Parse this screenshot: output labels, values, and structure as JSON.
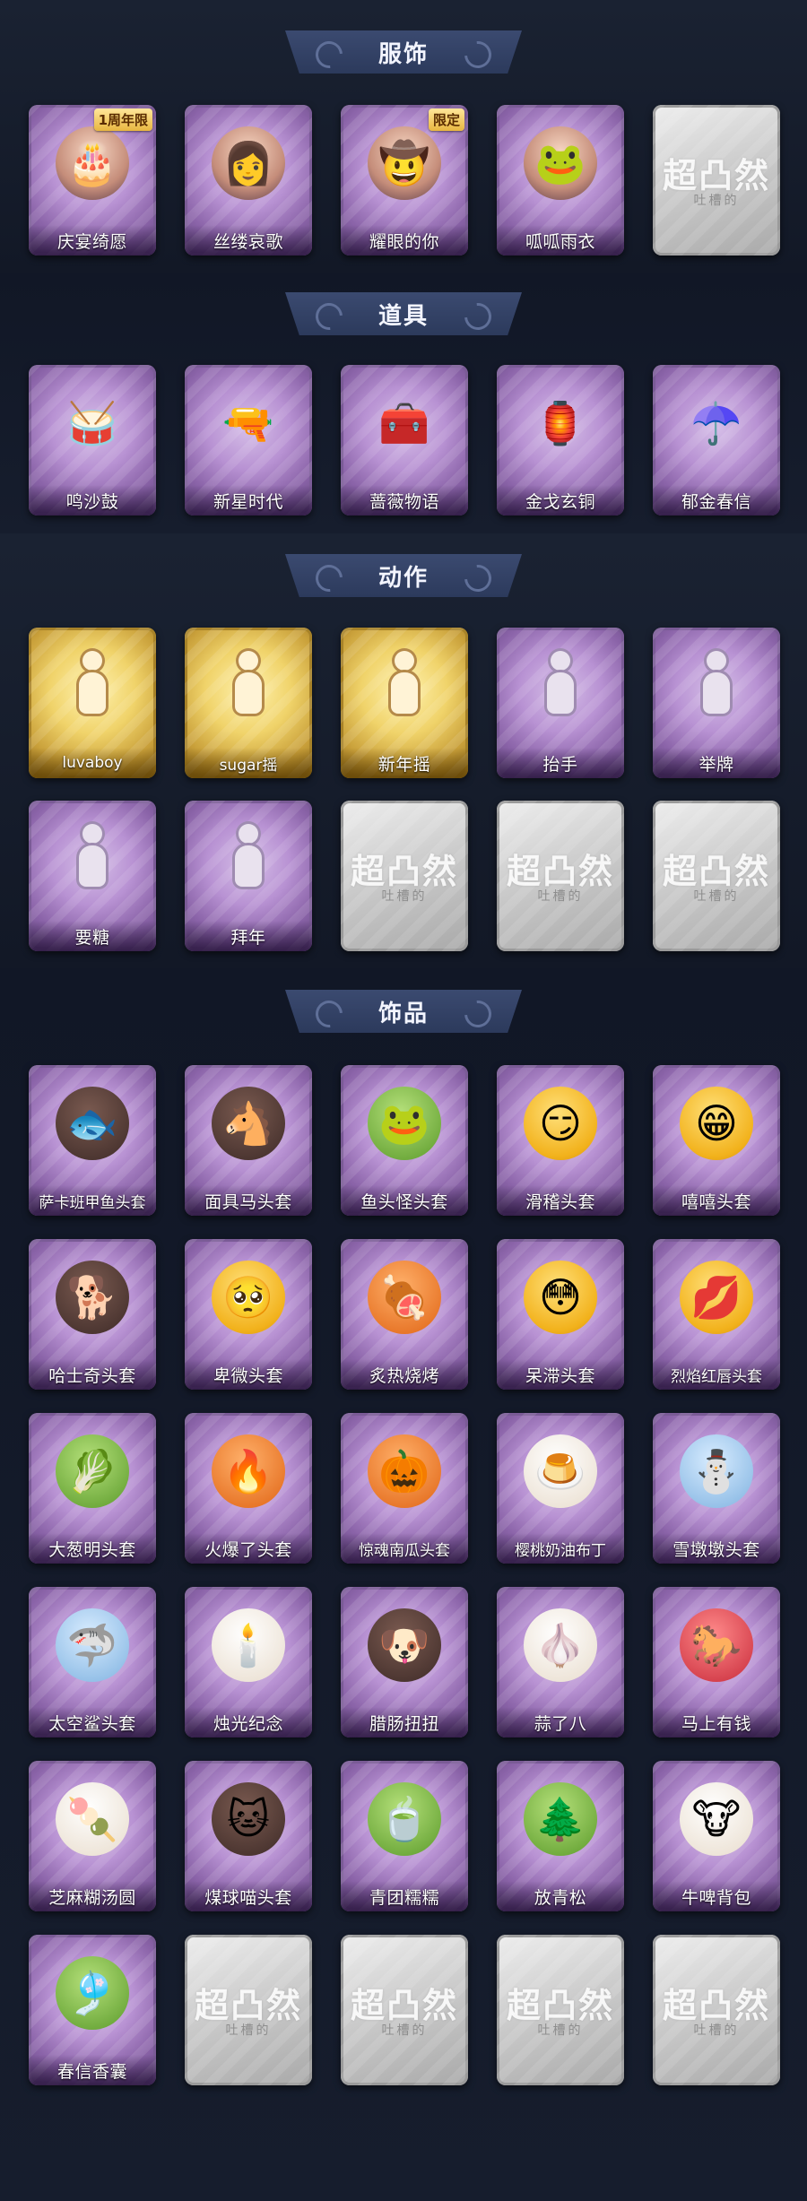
{
  "sections": {
    "clothing": {
      "title": "服饰",
      "items": [
        {
          "label": "庆宴绮愿",
          "badge": "1周年限",
          "style": "person",
          "glyph": "🎂"
        },
        {
          "label": "丝缕哀歌",
          "style": "person",
          "glyph": "👩"
        },
        {
          "label": "耀眼的你",
          "badge": "限定",
          "style": "person",
          "glyph": "🤠"
        },
        {
          "label": "呱呱雨衣",
          "style": "person",
          "glyph": "🐸"
        },
        {
          "label": "",
          "locked": true,
          "watermark": "超凸然",
          "watermark_sub": "吐槽的"
        }
      ]
    },
    "props": {
      "title": "道具",
      "items": [
        {
          "label": "鸣沙鼓",
          "glyph": "🥁"
        },
        {
          "label": "新星时代",
          "glyph": "🔫"
        },
        {
          "label": "蔷薇物语",
          "glyph": "🧰"
        },
        {
          "label": "金戈玄铜",
          "glyph": "🏮"
        },
        {
          "label": "郁金春信",
          "glyph": "☂️"
        }
      ]
    },
    "actions": {
      "title": "动作",
      "items": [
        {
          "label": "luvaboy",
          "gold": true
        },
        {
          "label": "sugar摇",
          "gold": true
        },
        {
          "label": "新年摇",
          "gold": true
        },
        {
          "label": "抬手"
        },
        {
          "label": "举牌"
        },
        {
          "label": "要糖"
        },
        {
          "label": "拜年"
        },
        {
          "label": "",
          "locked": true,
          "watermark": "超凸然",
          "watermark_sub": "吐槽的"
        },
        {
          "label": "",
          "locked": true,
          "watermark": "超凸然",
          "watermark_sub": "吐槽的"
        },
        {
          "label": "",
          "locked": true,
          "watermark": "超凸然",
          "watermark_sub": "吐槽的"
        }
      ]
    },
    "accessories": {
      "title": "饰品",
      "items": [
        {
          "label": "萨卡班甲鱼头套",
          "style": "dark",
          "glyph": "🐟"
        },
        {
          "label": "面具马头套",
          "style": "dark",
          "glyph": "🐴"
        },
        {
          "label": "鱼头怪头套",
          "style": "green",
          "glyph": "🐸"
        },
        {
          "label": "滑稽头套",
          "style": "face",
          "glyph": "😏"
        },
        {
          "label": "嘻嘻头套",
          "style": "face",
          "glyph": "😁"
        },
        {
          "label": "哈士奇头套",
          "style": "dark",
          "glyph": "🐕"
        },
        {
          "label": "卑微头套",
          "style": "face",
          "glyph": "🥺"
        },
        {
          "label": "炙热烧烤",
          "style": "orange",
          "glyph": "🍖"
        },
        {
          "label": "呆滞头套",
          "style": "face",
          "glyph": "😳"
        },
        {
          "label": "烈焰红唇头套",
          "style": "face",
          "glyph": "💋"
        },
        {
          "label": "大葱明头套",
          "style": "green",
          "glyph": "🥬"
        },
        {
          "label": "火爆了头套",
          "style": "orange",
          "glyph": "🔥"
        },
        {
          "label": "惊魂南瓜头套",
          "style": "orange",
          "glyph": "🎃"
        },
        {
          "label": "樱桃奶油布丁",
          "style": "white",
          "glyph": "🍮"
        },
        {
          "label": "雪墩墩头套",
          "style": "blue",
          "glyph": "⛄"
        },
        {
          "label": "太空鲨头套",
          "style": "blue",
          "glyph": "🦈"
        },
        {
          "label": "烛光纪念",
          "style": "white",
          "glyph": "🕯️"
        },
        {
          "label": "腊肠扭扭",
          "style": "dark",
          "glyph": "🐶"
        },
        {
          "label": "蒜了八",
          "style": "white",
          "glyph": "🧄"
        },
        {
          "label": "马上有钱",
          "style": "red",
          "glyph": "🐎"
        },
        {
          "label": "芝麻糊汤圆",
          "style": "white",
          "glyph": "🍡"
        },
        {
          "label": "煤球喵头套",
          "style": "dark",
          "glyph": "🐱"
        },
        {
          "label": "青团糯糯",
          "style": "green",
          "glyph": "🍵"
        },
        {
          "label": "放青松",
          "style": "green",
          "glyph": "🌲"
        },
        {
          "label": "牛啤背包",
          "style": "white",
          "glyph": "🐮"
        },
        {
          "label": "春信香囊",
          "style": "green",
          "glyph": "🎐"
        },
        {
          "label": "",
          "locked": true,
          "watermark": "超凸然",
          "watermark_sub": "吐槽的"
        },
        {
          "label": "",
          "locked": true,
          "watermark": "超凸然",
          "watermark_sub": "吐槽的"
        },
        {
          "label": "",
          "locked": true,
          "watermark": "超凸然",
          "watermark_sub": "吐槽的"
        },
        {
          "label": "",
          "locked": true,
          "watermark": "超凸然",
          "watermark_sub": "吐槽的"
        }
      ]
    }
  }
}
